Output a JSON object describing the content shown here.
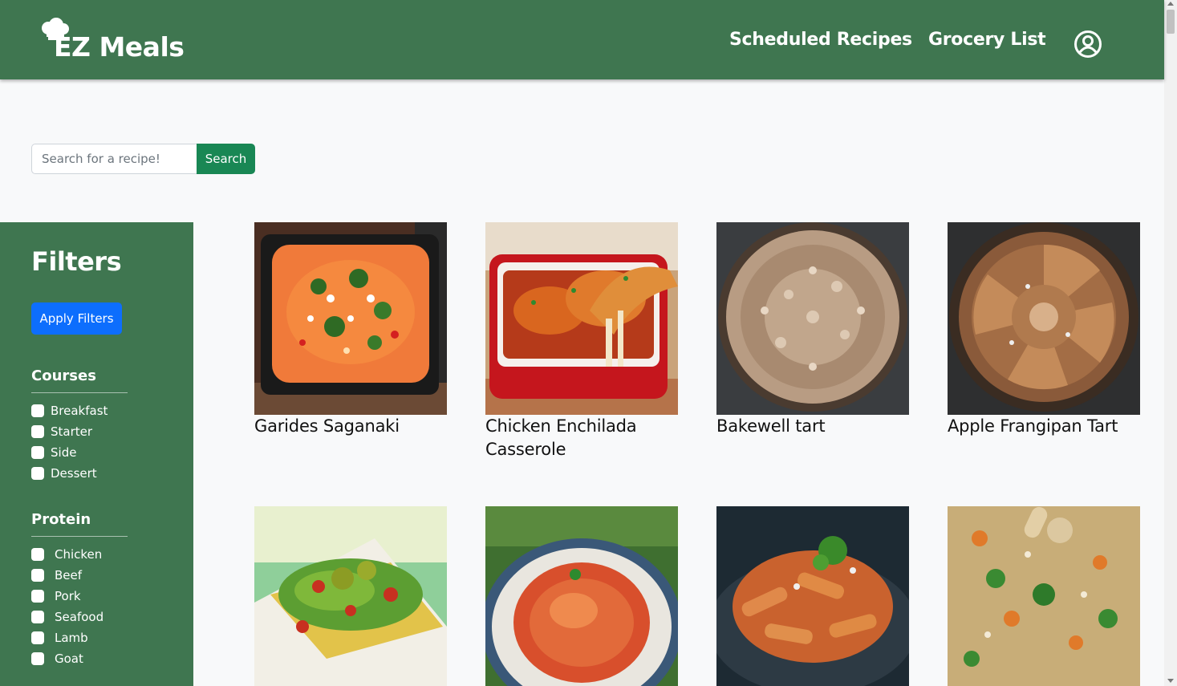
{
  "nav": {
    "brand": "EZ Meals",
    "links": [
      "Scheduled Recipes",
      "Grocery List"
    ]
  },
  "search": {
    "placeholder": "Search for a recipe!",
    "value": "",
    "button_label": "Search"
  },
  "filters": {
    "title": "Filters",
    "apply_label": "Apply Filters",
    "groups": [
      {
        "title": "Courses",
        "options": [
          "Breakfast",
          "Starter",
          "Side",
          "Dessert"
        ]
      },
      {
        "title": "Protein",
        "options": [
          "Chicken",
          "Beef",
          "Pork",
          "Seafood",
          "Lamb",
          "Goat"
        ]
      }
    ]
  },
  "recipes": [
    {
      "title": "Garides Saganaki"
    },
    {
      "title": "Chicken Enchilada Casserole"
    },
    {
      "title": "Bakewell tart"
    },
    {
      "title": "Apple Frangipan Tart"
    },
    {
      "title": ""
    },
    {
      "title": ""
    },
    {
      "title": ""
    },
    {
      "title": ""
    }
  ],
  "colors": {
    "navbar": "#3f7650",
    "sidebar": "#3f7650",
    "search_button": "#198754",
    "apply_button": "#0d6efd",
    "background": "#f8f9fa"
  },
  "icons": {
    "logo": "chef-hat-icon",
    "account": "user-circle-icon"
  }
}
